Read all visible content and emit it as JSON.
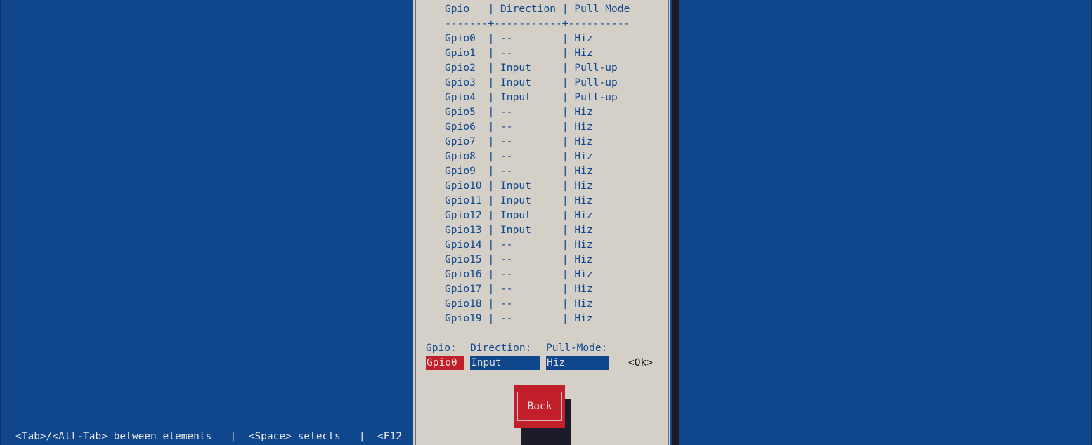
{
  "table": {
    "header": "Gpio   | Direction | Pull Mode",
    "separator": "-------+-----------+----------",
    "rows": [
      "Gpio0  | --        | Hiz",
      "Gpio1  | --        | Hiz",
      "Gpio2  | Input     | Pull-up",
      "Gpio3  | Input     | Pull-up",
      "Gpio4  | Input     | Pull-up",
      "Gpio5  | --        | Hiz",
      "Gpio6  | --        | Hiz",
      "Gpio7  | --        | Hiz",
      "Gpio8  | --        | Hiz",
      "Gpio9  | --        | Hiz",
      "Gpio10 | Input     | Hiz",
      "Gpio11 | Input     | Hiz",
      "Gpio12 | Input     | Hiz",
      "Gpio13 | Input     | Hiz",
      "Gpio14 | --        | Hiz",
      "Gpio15 | --        | Hiz",
      "Gpio16 | --        | Hiz",
      "Gpio17 | --        | Hiz",
      "Gpio18 | --        | Hiz",
      "Gpio19 | --        | Hiz"
    ]
  },
  "form": {
    "gpio_label": "Gpio:",
    "direction_label": "Direction:",
    "pull_mode_label": "Pull-Mode:",
    "gpio_value": "Gpio0",
    "direction_value": "Input",
    "pull_mode_value": "Hiz",
    "ok_label": "<Ok>"
  },
  "buttons": {
    "back_label": "Back"
  },
  "status_bar": {
    "text": "<Tab>/<Alt-Tab> between elements   |  <Space> selects   |  <F12"
  },
  "colors": {
    "background": "#10468c",
    "dialog": "#d4d0c8",
    "accent_red": "#c1202b",
    "shadow": "#1b1b2a"
  }
}
